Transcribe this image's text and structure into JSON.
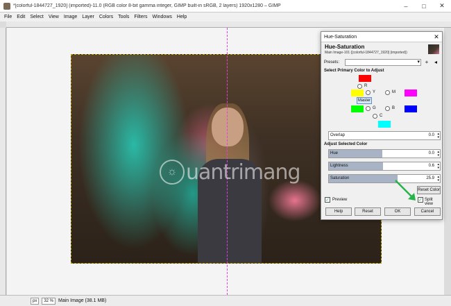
{
  "window": {
    "title": "*[colorful-1844727_1920] (imported)-11.0 (RGB color 8-bit gamma integer, GIMP built-in sRGB, 2 layers) 1920x1280 – GIMP"
  },
  "menu": [
    "File",
    "Edit",
    "Select",
    "View",
    "Image",
    "Layer",
    "Colors",
    "Tools",
    "Filters",
    "Windows",
    "Help"
  ],
  "status": {
    "unit": "px",
    "zoom": "32 %",
    "message": "Main Image (38.1 MB)"
  },
  "watermark": {
    "text": "uantrimang"
  },
  "dialog": {
    "window_title": "Hue-Saturation",
    "heading": "Hue-Saturation",
    "subheading": "Main Image-101 ([colorful-1844727_1920] (imported))",
    "presets_label": "Presets:",
    "section_primary": "Select Primary Color to Adjust",
    "colors": {
      "R": {
        "label": "R",
        "hex": "#ff0000"
      },
      "Y": {
        "label": "Y",
        "hex": "#ffff00"
      },
      "G": {
        "label": "G",
        "hex": "#00ff00"
      },
      "C": {
        "label": "C",
        "hex": "#00ffff"
      },
      "B": {
        "label": "B",
        "hex": "#0000ff"
      },
      "M": {
        "label": "M",
        "hex": "#ff00ff"
      }
    },
    "master_label": "Master",
    "overlap": {
      "label": "Overlap",
      "value": "0.0"
    },
    "section_adjust": "Adjust Selected Color",
    "hue": {
      "label": "Hue",
      "value": "0.0"
    },
    "lightness": {
      "label": "Lightness",
      "value": "0.6"
    },
    "saturation": {
      "label": "Saturation",
      "value": "25.9"
    },
    "reset_color": "Reset Color",
    "preview_label": "Preview",
    "split_view_label": "Split view",
    "help": "Help",
    "reset": "Reset",
    "ok": "OK",
    "cancel": "Cancel"
  }
}
